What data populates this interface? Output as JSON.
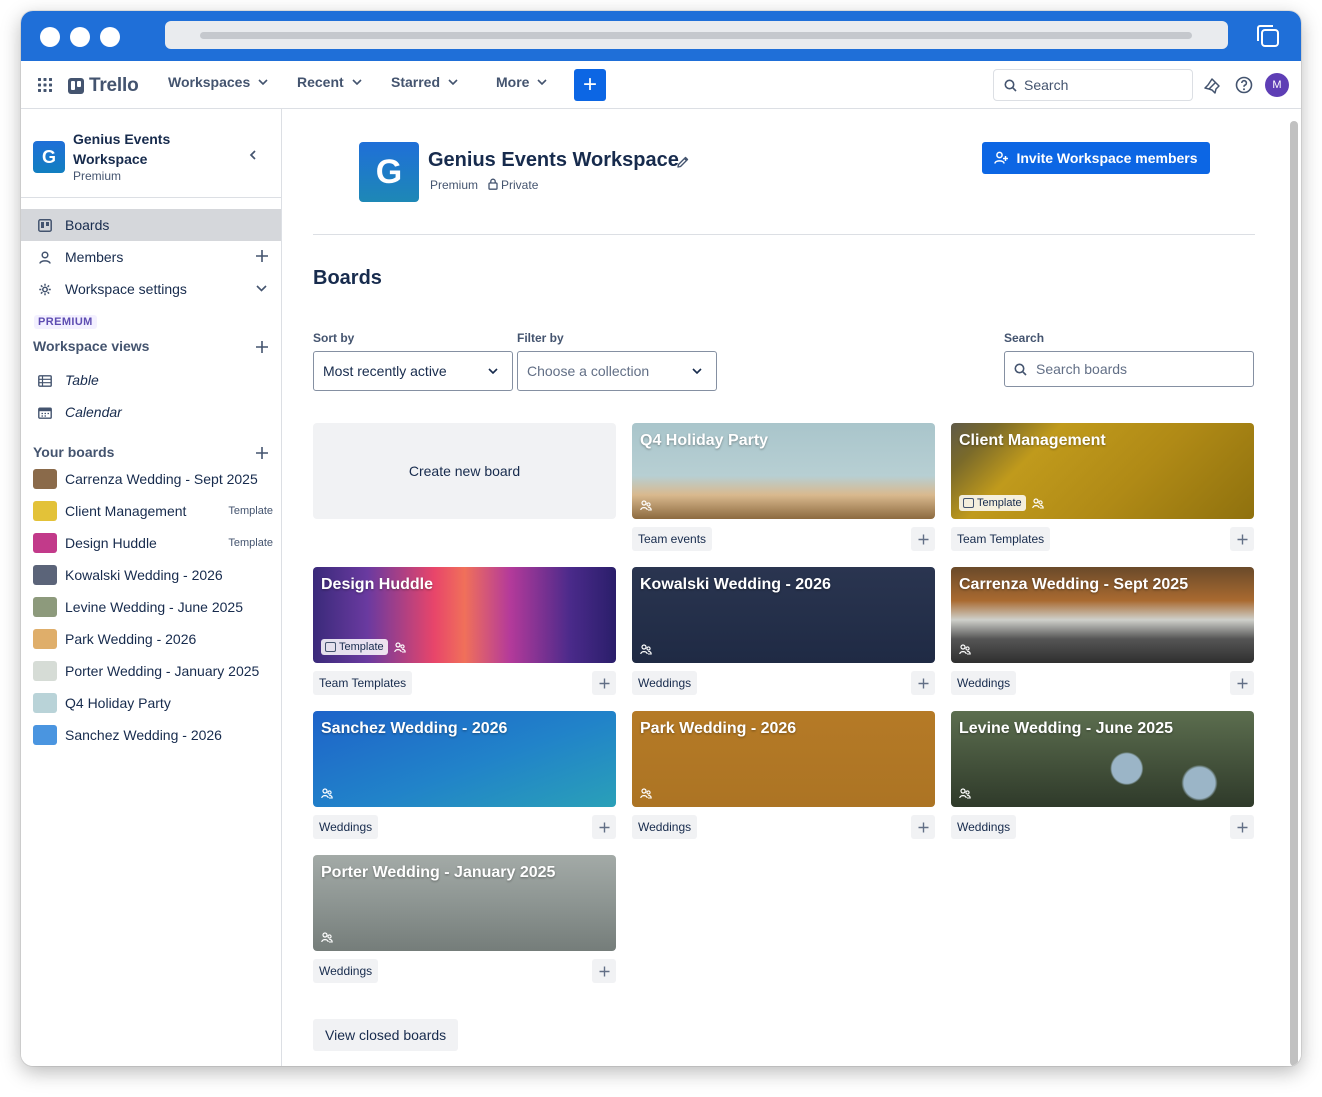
{
  "header": {
    "logo": "Trello",
    "nav": [
      "Workspaces",
      "Recent",
      "Starred",
      "More"
    ],
    "create_label": "+",
    "search_placeholder": "Search",
    "avatar_initial": "M"
  },
  "sidebar": {
    "workspace_initial": "G",
    "workspace_name": "Genius Events Workspace",
    "workspace_plan": "Premium",
    "menu": [
      {
        "label": "Boards",
        "icon": "board-icon"
      },
      {
        "label": "Members",
        "icon": "person-icon"
      },
      {
        "label": "Workspace settings",
        "icon": "gear-icon"
      }
    ],
    "premium_badge": "PREMIUM",
    "views_heading": "Workspace views",
    "views": [
      {
        "label": "Table",
        "icon": "table-icon"
      },
      {
        "label": "Calendar",
        "icon": "calendar-icon"
      }
    ],
    "boards_heading": "Your boards",
    "boards": [
      {
        "name": "Carrenza Wedding - Sept 2025",
        "tag": "",
        "color": "#8a6a4a"
      },
      {
        "name": "Client Management",
        "tag": "Template",
        "color": "#e3c238"
      },
      {
        "name": "Design Huddle",
        "tag": "Template",
        "color": "#c23a8a"
      },
      {
        "name": "Kowalski Wedding - 2026",
        "tag": "",
        "color": "#5b6479"
      },
      {
        "name": "Levine Wedding - June 2025",
        "tag": "",
        "color": "#8d9a7c"
      },
      {
        "name": "Park Wedding - 2026",
        "tag": "",
        "color": "#dfae6a"
      },
      {
        "name": "Porter Wedding - January 2025",
        "tag": "",
        "color": "#d6dcd6"
      },
      {
        "name": "Q4 Holiday Party",
        "tag": "",
        "color": "#b9d3d8"
      },
      {
        "name": "Sanchez Wedding - 2026",
        "tag": "",
        "color": "#4a95e0"
      }
    ]
  },
  "main": {
    "workspace_initial": "G",
    "workspace_title": "Genius Events Workspace",
    "plan": "Premium",
    "visibility": "Private",
    "invite_label": "Invite Workspace members",
    "boards_heading": "Boards",
    "sort_label": "Sort by",
    "sort_value": "Most recently active",
    "filter_label": "Filter by",
    "filter_placeholder": "Choose a collection",
    "search_label": "Search",
    "search_placeholder": "Search boards",
    "create_board_label": "Create new board",
    "template_badge": "Template",
    "closed_boards_label": "View closed boards",
    "tiles": [
      {
        "title": "Q4 Holiday Party",
        "collection": "Team events",
        "template": false,
        "bg": "cupcakes"
      },
      {
        "title": "Client Management",
        "collection": "Team Templates",
        "template": true,
        "bg": "mustard"
      },
      {
        "title": "Design Huddle",
        "collection": "Team Templates",
        "template": true,
        "bg": "neon"
      },
      {
        "title": "Kowalski Wedding - 2026",
        "collection": "Weddings",
        "template": false,
        "bg": "navy"
      },
      {
        "title": "Carrenza Wedding - Sept 2025",
        "collection": "Weddings",
        "template": false,
        "bg": "forest"
      },
      {
        "title": "Sanchez Wedding - 2026",
        "collection": "Weddings",
        "template": false,
        "bg": "blue"
      },
      {
        "title": "Park Wedding - 2026",
        "collection": "Weddings",
        "template": false,
        "bg": "amber"
      },
      {
        "title": "Levine Wedding - June 2025",
        "collection": "Weddings",
        "template": false,
        "bg": "daisies"
      },
      {
        "title": "Porter Wedding - January 2025",
        "collection": "Weddings",
        "template": false,
        "bg": "grass"
      }
    ]
  },
  "colors": {
    "brand_blue": "#0c66e4",
    "chrome_blue": "#1f6fd8",
    "text": "#172b4d",
    "subtle_text": "#44546f"
  }
}
